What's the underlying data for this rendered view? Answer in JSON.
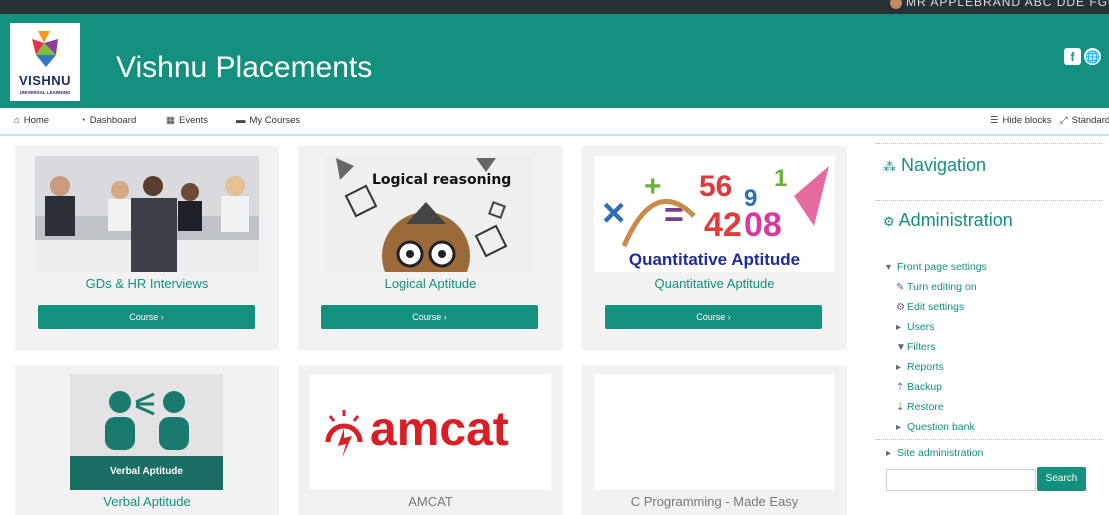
{
  "topbar": {
    "user_name": "MR APPLEBRAND ABC DDE FGG"
  },
  "header": {
    "logo_brand": "VISHNU",
    "logo_sub": "UNIVERSAL LEARNING",
    "site_title": "Vishnu Placements",
    "social": [
      "f",
      "🌐"
    ]
  },
  "nav": {
    "home": "Home",
    "dashboard": "Dashboard",
    "events": "Events",
    "my_courses": "My Courses",
    "hide_blocks": "Hide blocks",
    "standard": "Standard"
  },
  "courses": [
    {
      "title": "GDs & HR Interviews",
      "button": "Course ›"
    },
    {
      "title": "Logical Aptitude",
      "image_text": "Logical reasoning",
      "button": "Course ›"
    },
    {
      "title": "Quantitative Aptitude",
      "image_text": "Quantitative Aptitude",
      "button": "Course ›"
    },
    {
      "title": "Verbal Aptitude",
      "image_text": "Verbal Aptitude"
    },
    {
      "title": "AMCAT",
      "image_text": "amcat"
    },
    {
      "title": "C Programming - Made Easy"
    }
  ],
  "sidebar": {
    "navigation_title": "Navigation",
    "administration_title": "Administration",
    "front_page_settings": "Front page settings",
    "items": [
      "Turn editing on",
      "Edit settings",
      "Users",
      "Filters",
      "Reports",
      "Backup",
      "Restore",
      "Question bank"
    ],
    "site_admin": "Site administration",
    "search_button": "Search"
  },
  "colors": {
    "brand": "#14907e",
    "topbar": "#263236"
  }
}
